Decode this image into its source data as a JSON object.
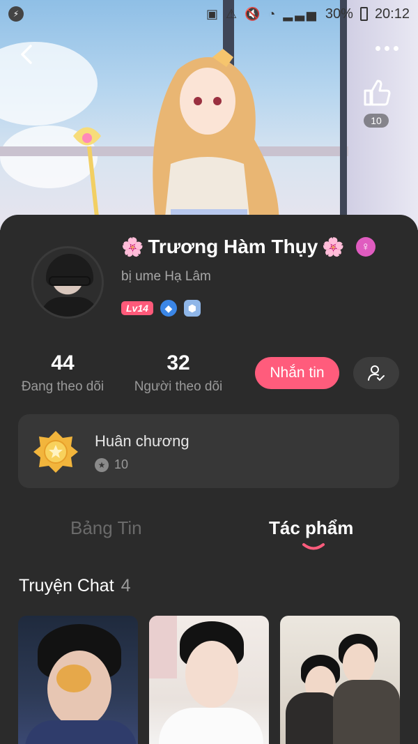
{
  "status_bar": {
    "battery": "30%",
    "time": "20:12"
  },
  "header": {
    "like_count": "10"
  },
  "profile": {
    "name": "Trương Hàm Thụy",
    "name_decoration": "🌸",
    "subtitle": "bị ume Hạ Lâm",
    "level_badge": "Lv14",
    "gender_icon": "female-symbol"
  },
  "stats": {
    "following_count": "44",
    "following_label": "Đang theo dõi",
    "followers_count": "32",
    "followers_label": "Người theo dõi"
  },
  "actions": {
    "message_label": "Nhắn tin"
  },
  "medals": {
    "title": "Huân chương",
    "count": "10"
  },
  "tabs": [
    {
      "label": "Bảng Tin",
      "active": false
    },
    {
      "label": "Tác phẩm",
      "active": true
    }
  ],
  "section": {
    "title": "Truyện Chat",
    "count": "4"
  },
  "colors": {
    "accent": "#ff5c7c",
    "sheet_background": "#2b2b2b",
    "card_background": "#373737"
  }
}
